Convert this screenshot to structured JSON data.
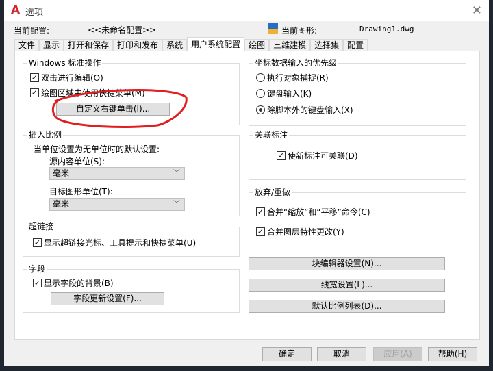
{
  "window": {
    "title": "选项",
    "close": "✕"
  },
  "profile": {
    "label": "当前配置:",
    "value": "<<未命名配置>>",
    "drawing_label": "当前图形:",
    "drawing_value": "Drawing1.dwg"
  },
  "tabs": [
    "文件",
    "显示",
    "打开和保存",
    "打印和发布",
    "系统",
    "用户系统配置",
    "绘图",
    "三维建模",
    "选择集",
    "配置"
  ],
  "active_tab": "用户系统配置",
  "windows_ops": {
    "title": "Windows 标准操作",
    "dblclick": "双击进行编辑(O)",
    "shortcut": "绘图区域中使用快捷菜单(M)",
    "right_click_btn": "自定义右键单击(I)..."
  },
  "insert_scale": {
    "title": "插入比例",
    "desc": "当单位设置为无单位时的默认设置:",
    "source_label": "源内容单位(S):",
    "source_value": "毫米",
    "target_label": "目标图形单位(T):",
    "target_value": "毫米"
  },
  "hyperlink": {
    "title": "超链接",
    "option": "显示超链接光标、工具提示和快捷菜单(U)"
  },
  "fields": {
    "title": "字段",
    "option": "显示字段的背景(B)",
    "btn": "字段更新设置(F)..."
  },
  "coord": {
    "title": "坐标数据输入的优先级",
    "options": [
      "执行对象捕捉(R)",
      "键盘输入(K)",
      "除脚本外的键盘输入(X)"
    ],
    "selected": 2
  },
  "assoc": {
    "title": "关联标注",
    "option": "使新标注可关联(D)"
  },
  "undo": {
    "title": "放弃/重做",
    "opt1": "合并“缩放”和“平移”命令(C)",
    "opt2": "合并图层特性更改(Y)"
  },
  "side_buttons": [
    "块编辑器设置(N)...",
    "线宽设置(L)...",
    "默认比例列表(D)..."
  ],
  "footer": {
    "ok": "确定",
    "cancel": "取消",
    "apply": "应用(A)",
    "help": "帮助(H)"
  },
  "annotation_color": "#e02020"
}
